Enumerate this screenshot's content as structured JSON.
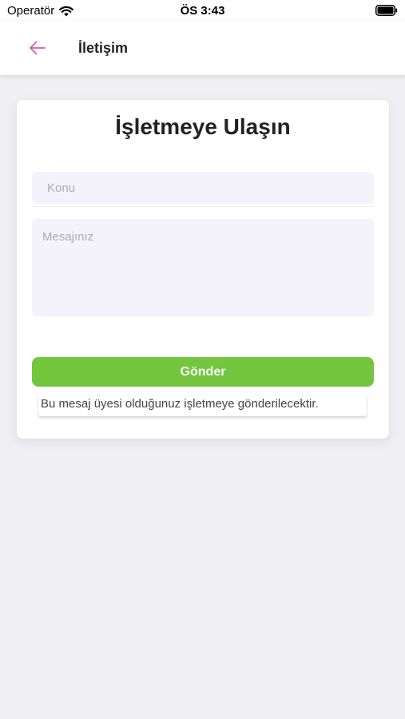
{
  "status_bar": {
    "carrier": "Operatör",
    "time": "ÖS 3:43"
  },
  "header": {
    "title": "İletişim",
    "back_icon": "arrow-left-icon",
    "accent_color": "#e0569f"
  },
  "form": {
    "title": "İşletmeye Ulaşın",
    "subject_placeholder": "Konu",
    "message_placeholder": "Mesajınız",
    "submit_label": "Gönder",
    "submit_color": "#73c63d",
    "note": "Bu mesaj üyesi olduğunuz işletmeye gönderilecektir."
  }
}
